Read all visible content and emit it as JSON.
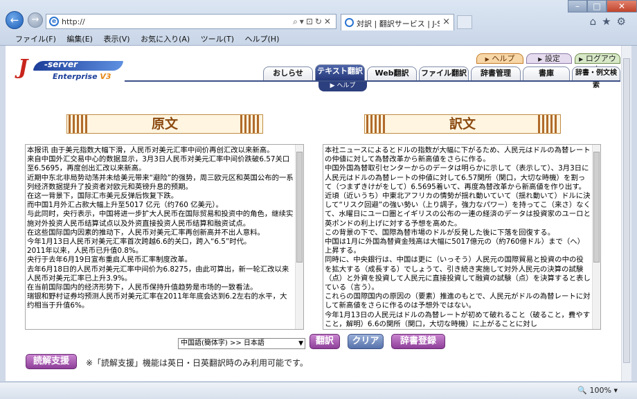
{
  "browser": {
    "address": "http://",
    "tab_title": "対訳 | 翻訳サービス | J-S...",
    "menu": [
      "ファイル(F)",
      "編集(E)",
      "表示(V)",
      "お気に入り(A)",
      "ツール(T)",
      "ヘルプ(H)"
    ],
    "zoom": "100%"
  },
  "logo": {
    "j": "J",
    "server": "-server",
    "enterprise": "Enterprise",
    "version": "V3"
  },
  "top_links": {
    "help": "ヘルプ",
    "settings": "設定",
    "logout": "ログアウト"
  },
  "tabs": [
    "おしらせ",
    "テキスト翻訳",
    "Web翻訳",
    "ファイル翻訳",
    "辞書管理",
    "書庫",
    "辞書・例文検索"
  ],
  "active_tab": "テキスト翻訳",
  "sub_help": "ヘルプ",
  "source": {
    "header": "原文",
    "text": "本报讯 由于美元指数大幅下滑，人民币对美元汇率中间价再创汇改以来新高。\n来自中国外汇交易中心的数据显示，3月3日人民币对美元汇率中间价跌破6.57关口至6.5695，再度创出汇改以来新高。\n近期中东北非局势动荡并未给美元带来“避险”的强势，周三欧元区和英国公布的一系列经济数据提升了投资者对欧元和英镑升息的预期。\n在这一背景下，国际汇市美元反弹后恢复下跌。\n而中国1月外汇占款大幅上升至5017 亿元（约760 亿美元）。\n与此同时，央行表示，中国将进一步扩大人民币在国际贸易和投资中的角色，继续实施对外投资人民币结算试点以及外资直接投资人民币结算和融资试点。\n在这些国际国内因素的推动下，人民币对美元汇率再创新高并不出人意料。\n今年1月13日人民币对美元汇率首次跨越6.6的关口，跨入“6.5”时代。\n2011年以来，人民币已升值0.8%。\n央行于去年6月19日宣布重启人民币汇率制度改革。\n去年6月18日的人民币对美元汇率中间价为6.8275，由此可算出，新一轮汇改以来人民币对美元汇率已上升3.9%。\n在当前国际国内的经济形势下，人民币保持升值趋势是市场的一致看法。\n瑞银和野村证券均预测人民币对美元汇率在2011年年底会达到6.2左右的水平，大约相当于升值6%。"
  },
  "target": {
    "header": "訳文",
    "text": "本社ニュースによるとドルの指数が大幅に下がるため、人民元はドルの為替レートの仲値に対して為替改革から新高値をさらに作る。\n中国外国為替取引センターからのデータは明らかに示して（表示して）、3月3日に人民元はドルの為替レートの仲値に対して6.57関所（関口，大切な時機）を割って（つまずきけがをして）6.5695着いて、再度為替改革から新高値を作り出す。\n近頃（近いうち）中東北アフリカの情勢が揺れ動いていて（揺れ動いて）ドルに決して“リスク回避”の強い勢い（上り調子，強力なパワー）を持ってこ（来さ）なくて、水曜日にユーロ圏とイギリスの公布の一連の経済のデータは投資家のユーロと英ポンドの利上げに対する予想を高めた。\nこの背景の下で、国際為替市場のドルが反発した後に下落を回復する。\n中国は1月に外国為替資金残高は大幅に5017億元の（約760億ドル）まで（へ）上昇する。\n同時に、中央銀行は、中国は更に（いっそう）人民元の国際貿易と投資の中の役を拡大する（成長する）でしょうて、引き続き実施して対外人民元の決算の試験（点）と外資を投資して人民元に直接投資して融資の試験（点）を決算すると表している（言う）。\nこれらの国際国内の原因の（要素）推進のもとで、人民元がドルの為替レートに対して新高値をさらに作るのは予想外ではない。\n今年1月13日の人民元はドルの為替レートが初めて破れること（破ること，費やすこと，解明）6.6の関所（関口，大切な時機）に上がることに対し"
  },
  "language_pair": "中国語(簡体字) >> 日本語",
  "buttons": {
    "translate": "翻訳",
    "clear": "クリア",
    "dict_register": "辞書登録",
    "reading_support": "読解支援"
  },
  "support_note": "※「読解支援」機能は英日・日英翻訳時のみ利用可能です。"
}
